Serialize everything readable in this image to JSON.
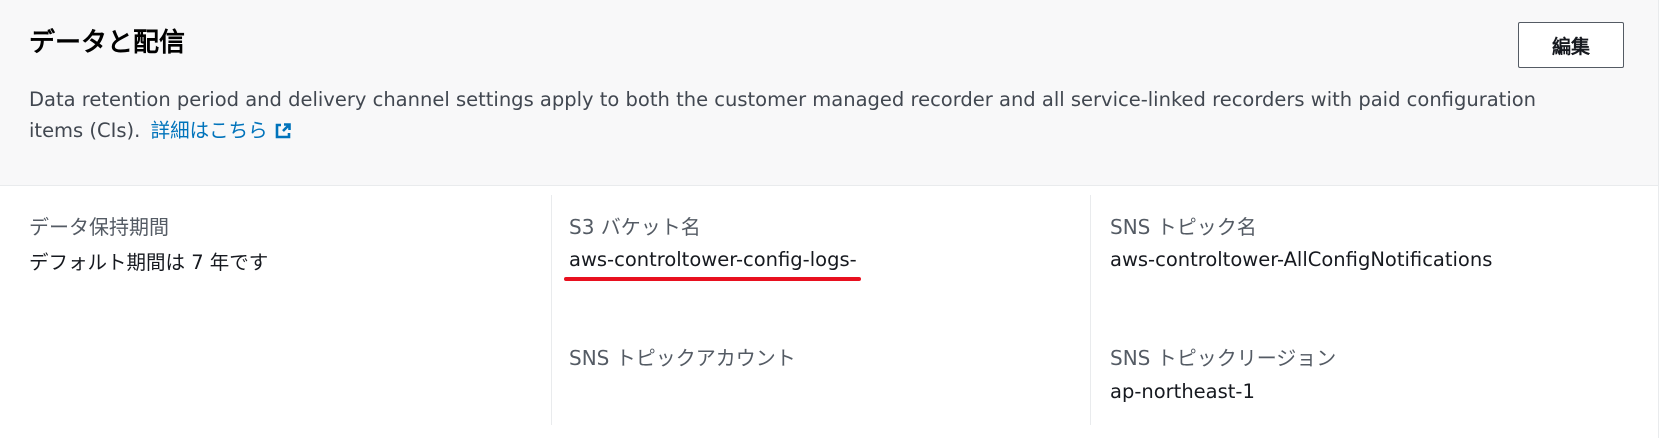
{
  "section": {
    "title": "データと配信",
    "edit_label": "編集",
    "description": "Data retention period and delivery channel settings apply to both the customer managed recorder and all service-linked recorders with paid configuration items (CIs).",
    "details_link": "詳細はこちら",
    "external_link_icon": "external-link-icon"
  },
  "fields": {
    "retention": {
      "label": "データ保持期間",
      "value": "デフォルト期間は 7 年です"
    },
    "s3_bucket": {
      "label": "S3 バケット名",
      "value": "aws-controltower-config-logs-"
    },
    "sns_topic": {
      "label": "SNS トピック名",
      "value": "aws-controltower-AllConfigNotifications"
    },
    "sns_account": {
      "label": "SNS トピックアカウント",
      "value": ""
    },
    "sns_region": {
      "label": "SNS トピックリージョン",
      "value": "ap-northeast-1"
    }
  },
  "colors": {
    "link": "#0073bb",
    "annotation_underline": "#e8101f",
    "header_background": "#f8f8f9"
  }
}
